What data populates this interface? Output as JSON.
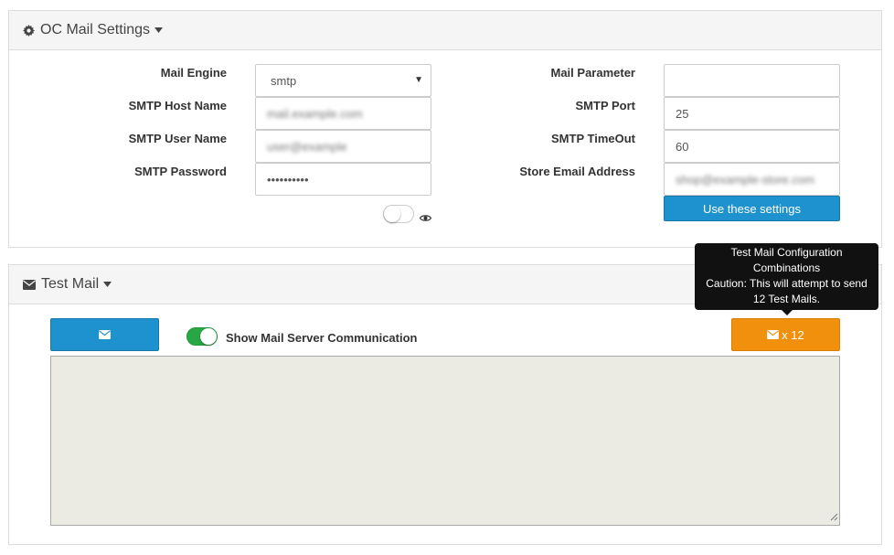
{
  "colors": {
    "primary_button": "#1e91cf",
    "warning_button": "#f0900d",
    "toggle_on": "#27a844",
    "textarea_bg": "#ebebe4"
  },
  "settings_panel": {
    "title": "OC Mail Settings",
    "icon": "gear-icon",
    "labels": {
      "mail_engine": "Mail Engine",
      "smtp_host": "SMTP Host Name",
      "smtp_user": "SMTP User Name",
      "smtp_password": "SMTP Password",
      "mail_parameter": "Mail Parameter",
      "smtp_port": "SMTP Port",
      "smtp_timeout": "SMTP TimeOut",
      "store_email": "Store Email Address"
    },
    "values": {
      "mail_engine": "smtp",
      "smtp_host": "mail.example.com",
      "smtp_user": "user@example",
      "smtp_password": "••••••••••",
      "mail_parameter": "",
      "smtp_port": "25",
      "smtp_timeout": "60",
      "store_email": "shop@example-store.com"
    },
    "use_settings_button": "Use these settings",
    "show_password_toggle": false
  },
  "test_panel": {
    "title": "Test Mail",
    "icon": "envelope-icon",
    "show_communication_label": "Show Mail Server Communication",
    "show_communication_toggle": true,
    "multi_send_button": "x 12",
    "tooltip_lines": [
      "Test Mail Configuration",
      "Combinations",
      "Caution: This will attempt to send",
      "12 Test Mails."
    ],
    "log_output": ""
  }
}
